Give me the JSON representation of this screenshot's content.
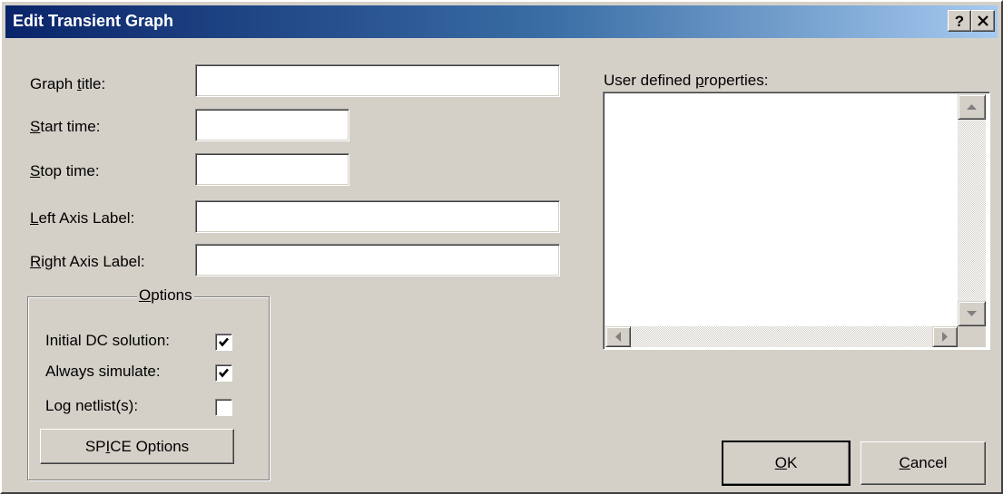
{
  "window": {
    "title": "Edit Transient Graph",
    "help_label": "?",
    "close_label": "×"
  },
  "fields": {
    "graph_title": {
      "label_pre": "Graph ",
      "label_key": "t",
      "label_post": "itle:",
      "value": ""
    },
    "start_time": {
      "label_pre": "",
      "label_key": "S",
      "label_post": "tart time:",
      "value": ""
    },
    "stop_time": {
      "label_pre": "",
      "label_key": "S",
      "label_post": "top time:",
      "value": ""
    },
    "left_axis": {
      "label_pre": "",
      "label_key": "L",
      "label_post": "eft Axis Label:",
      "value": ""
    },
    "right_axis": {
      "label_pre": "",
      "label_key": "R",
      "label_post": "ight Axis Label:",
      "value": ""
    }
  },
  "options": {
    "legend_key": "O",
    "legend_post": "ptions",
    "initial_dc": {
      "label": "Initial DC solution:",
      "checked": true
    },
    "always_simulate": {
      "label": "Always simulate:",
      "checked": true
    },
    "log_netlist": {
      "label": "Log netlist(s):",
      "checked": false
    },
    "spice_button": {
      "pre": "SP",
      "key": "I",
      "post": "CE Options"
    }
  },
  "user_props": {
    "label_pre": "User defined ",
    "label_key": "p",
    "label_post": "roperties:",
    "content": ""
  },
  "buttons": {
    "ok": {
      "key": "O",
      "post": "K"
    },
    "cancel": {
      "key": "C",
      "post": "ancel"
    }
  },
  "icons": {
    "check": "checkmark-icon",
    "scroll_up": "triangle-up-icon",
    "scroll_down": "triangle-down-icon",
    "scroll_left": "triangle-left-icon",
    "scroll_right": "triangle-right-icon"
  },
  "colors": {
    "titlebar_start": "#0a246a",
    "titlebar_end": "#a6caf0",
    "dialog_face": "#d4d0c8"
  }
}
